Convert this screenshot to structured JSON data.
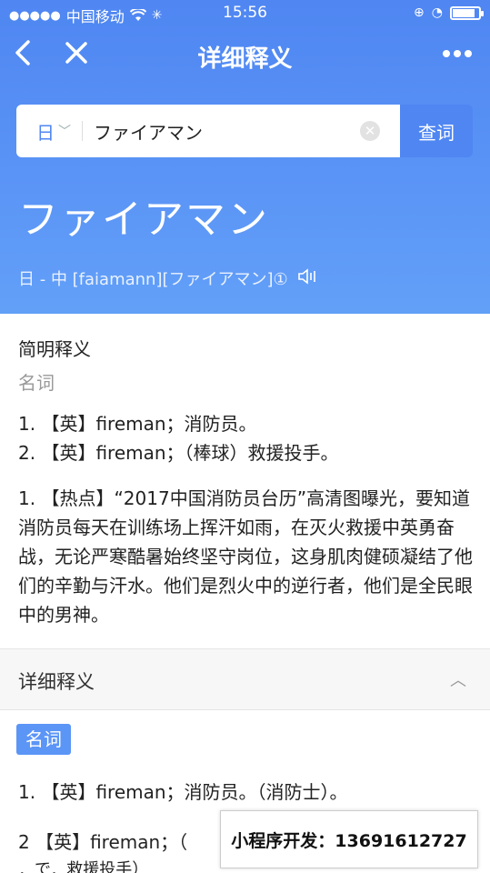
{
  "status_bar": {
    "carrier": "中国移动",
    "time": "15:56",
    "battery_level": 0.85
  },
  "nav": {
    "title": "详细释义",
    "back_icon": "chevron-left-icon",
    "close_icon": "close-icon",
    "more_icon": "more-icon"
  },
  "search": {
    "lang": "日",
    "query": "ファイアマン",
    "button": "查词"
  },
  "entry": {
    "headword": "ファイアマン",
    "pronunciation": "日 - 中 [faiamann][ファイアマン]①"
  },
  "brief": {
    "title": "简明释义",
    "pos": "名词",
    "defs": [
      "1. 【英】fireman；消防员。",
      "2. 【英】fireman；（棒球）救援投手。"
    ],
    "hot": "1. 【热点】“2017中国消防员台历”高清图曝光，要知道消防员每天在训练场上挥汗如雨，在灭火救援中英勇奋战，无论严寒酷暑始终坚守岗位，这身肌肉健硕凝结了他们的辛勤与汗水。他们是烈火中的逆行者，他们是全民眼中的男神。"
  },
  "detail": {
    "title": "详细释义",
    "pos": "名词",
    "defs": [
      "1. 【英】fireman；消防员。（消防士）。",
      "2 【英】fireman；（",
      "．で．救援投手）"
    ]
  },
  "watermark": "小程序开发：13691612727",
  "colors": {
    "primary": "#4f86f2",
    "tag": "#5b95f6"
  }
}
